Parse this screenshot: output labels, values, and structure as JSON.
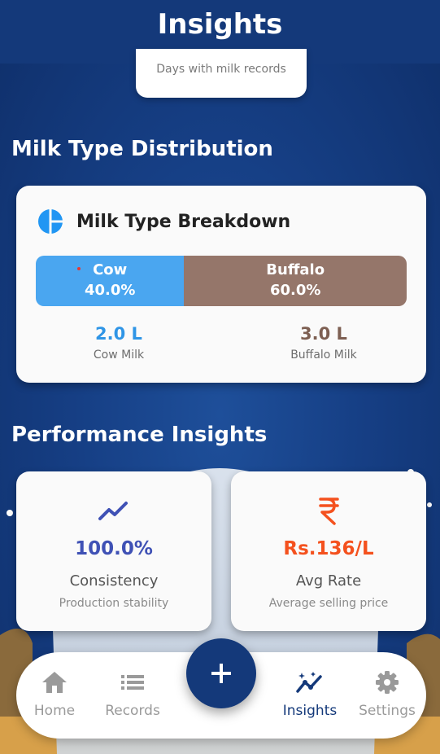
{
  "header": {
    "title": "Insights"
  },
  "summary_card": {
    "label": "Days with milk records"
  },
  "sections": {
    "milk_type": "Milk Type Distribution",
    "performance": "Performance Insights"
  },
  "milk_breakdown": {
    "title": "Milk Type Breakdown",
    "cow": {
      "name": "Cow",
      "percent_text": "40.0%",
      "share": 0.4,
      "amount": "2.0 L",
      "amount_label": "Cow Milk",
      "color": "#4aa6f0"
    },
    "buffalo": {
      "name": "Buffalo",
      "percent_text": "60.0%",
      "share": 0.6,
      "amount": "3.0 L",
      "amount_label": "Buffalo Milk",
      "color": "#95766a"
    }
  },
  "performance": {
    "consistency": {
      "icon": "trending-up-icon",
      "value": "100.0%",
      "label": "Consistency",
      "sub": "Production stability",
      "color": "#3f51b5"
    },
    "avg_rate": {
      "icon": "rupee-icon",
      "value": "Rs.136/L",
      "label": "Avg Rate",
      "sub": "Average selling price",
      "color": "#f4511e"
    }
  },
  "nav": {
    "home": "Home",
    "records": "Records",
    "insights": "Insights",
    "settings": "Settings",
    "active": "insights"
  },
  "colors": {
    "primary": "#14397a",
    "inactive": "#9a9a9a"
  }
}
